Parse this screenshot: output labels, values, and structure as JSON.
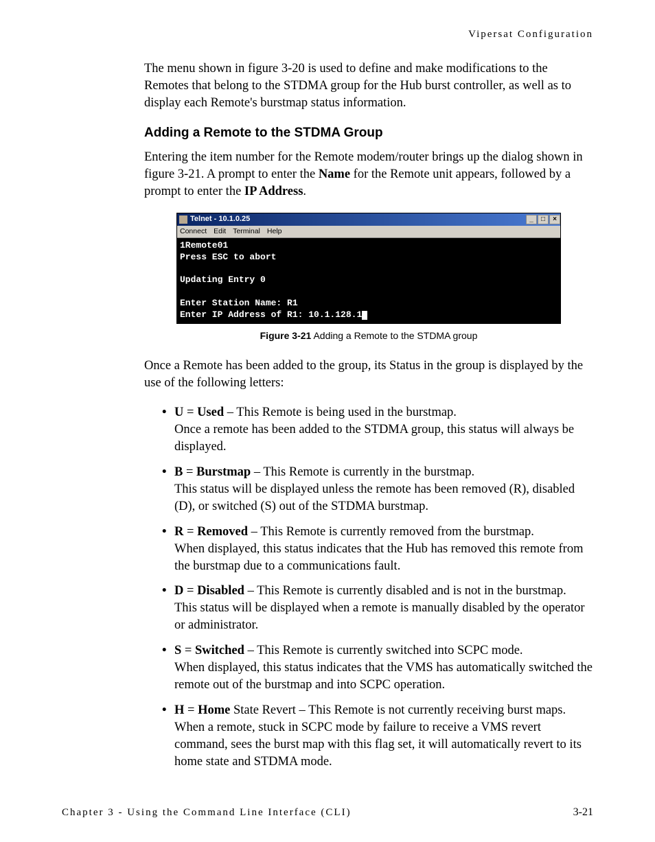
{
  "header": {
    "section": "Vipersat Configuration"
  },
  "para1": "The menu shown in figure 3-20 is used to define and make modifications to the Remotes that belong to the STDMA group for the Hub burst controller, as well as to display each Remote's burstmap status information.",
  "heading2": "Adding a Remote to the STDMA Group",
  "para2_pre": "Entering the item number for the Remote modem/router brings up the dialog shown in figure 3-21. A prompt to enter the ",
  "para2_name": "Name",
  "para2_mid": " for the Remote unit appears, followed by a prompt to enter the ",
  "para2_ip": "IP Address",
  "para2_post": ".",
  "terminal": {
    "title": "Telnet - 10.1.0.25",
    "menus": {
      "m1": "Connect",
      "m2": "Edit",
      "m3": "Terminal",
      "m4": "Help"
    },
    "line1": "1Remote01",
    "line2": "Press ESC to abort",
    "line3": "",
    "line4": "Updating Entry 0",
    "line5": "",
    "line6": "Enter Station Name: R1",
    "line7": "Enter IP Address of R1: 10.1.128.1"
  },
  "figcap": {
    "label": "Figure 3-21",
    "text": "   Adding a Remote to the STDMA group"
  },
  "para3": "Once a Remote has been added to the group, its Status in the group is displayed by the use of the following letters:",
  "items": {
    "u": {
      "code": "U",
      "eq": " = ",
      "term": "Used",
      "tail": " – This Remote is being used in the burstmap.",
      "detail": "Once a remote has been added to the STDMA group, this status will always be displayed."
    },
    "b": {
      "code": "B",
      "eq": " = ",
      "term": "Burstmap",
      "tail": " – This Remote is currently in the burstmap.",
      "detail": "This status will be displayed unless the remote has been removed (R), disabled (D), or switched (S) out of the STDMA burstmap."
    },
    "r": {
      "code": "R",
      "eq": " = ",
      "term": "Removed",
      "tail": " – This Remote is currently removed from the burstmap.",
      "detail": "When displayed, this status indicates that the Hub has removed this remote from the burstmap due to a communications fault."
    },
    "d": {
      "code": "D",
      "eq": " = ",
      "term": "Disabled",
      "tail": " – This Remote is currently disabled and is not in the burstmap.",
      "detail": "This status will be displayed when a remote is manually disabled by the operator or administrator."
    },
    "s": {
      "code": "S",
      "eq": " = ",
      "term": "Switched",
      "tail": " – This Remote is currently switched into SCPC mode.",
      "detail": "When displayed, this status indicates that the VMS has automatically switched the remote out of the burstmap and into SCPC operation."
    },
    "h": {
      "code": "H",
      "eq": " = ",
      "term": "Home",
      "tail": " State Revert – This Remote is not currently receiving burst maps. When a remote, stuck in SCPC mode by failure to receive a VMS revert command, sees the burst map with this flag set, it will automatically revert to its home state and STDMA mode."
    }
  },
  "footer": {
    "chapter": "Chapter 3 - Using the Command Line Interface (CLI)",
    "page": "3-21"
  }
}
